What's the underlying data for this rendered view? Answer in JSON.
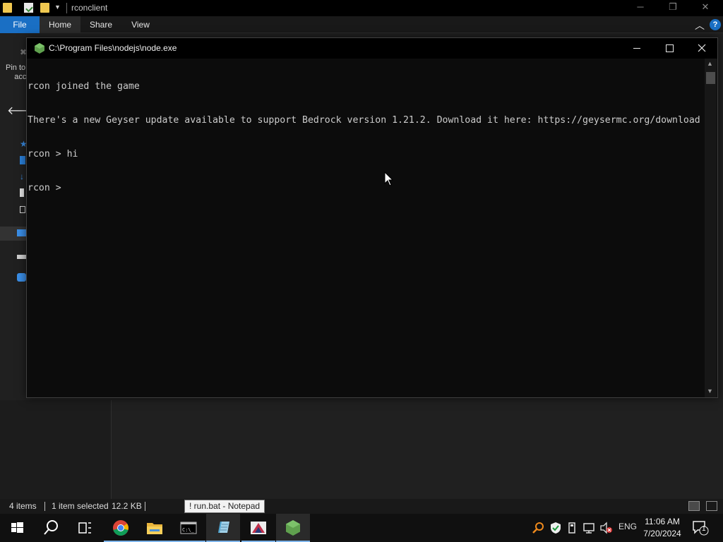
{
  "explorer": {
    "title": "rconclient",
    "ribbon_tabs": {
      "file": "File",
      "home": "Home",
      "share": "Share",
      "view": "View"
    },
    "help_label": "?",
    "pin_label": "Pin to\n    acc",
    "status": {
      "items": "4 items",
      "selected": "1 item selected",
      "size": "12.2 KB"
    }
  },
  "console": {
    "title": "C:\\Program Files\\nodejs\\node.exe",
    "lines": [
      "rcon joined the game",
      "There's a new Geyser update available to support Bedrock version 1.21.2. Download it here: https://geysermc.org/download",
      "rcon > hi",
      "rcon > "
    ]
  },
  "tooltip": {
    "text": "! run.bat - Notepad"
  },
  "taskbar": {
    "items": [
      {
        "name": "start-button",
        "icon": "windows-logo-icon"
      },
      {
        "name": "search-button",
        "icon": "search-icon"
      },
      {
        "name": "task-view-button",
        "icon": "task-view-icon"
      },
      {
        "name": "chrome-button",
        "icon": "chrome-icon"
      },
      {
        "name": "file-explorer-button",
        "icon": "folder-icon"
      },
      {
        "name": "terminal-button",
        "icon": "cmd-icon"
      },
      {
        "name": "notepad-button",
        "icon": "notepad-icon"
      },
      {
        "name": "app-button",
        "icon": "app-icon"
      },
      {
        "name": "node-button",
        "icon": "nodejs-icon"
      }
    ],
    "language": "ENG",
    "time": "11:06 AM",
    "date": "7/20/2024",
    "notification_count": "1"
  },
  "colors": {
    "accent": "#1a6fc4",
    "console_bg": "#0c0c0c",
    "console_text": "#cccccc",
    "taskbar_underline": "#7eb4ea",
    "node_green": "#5fa04e"
  }
}
